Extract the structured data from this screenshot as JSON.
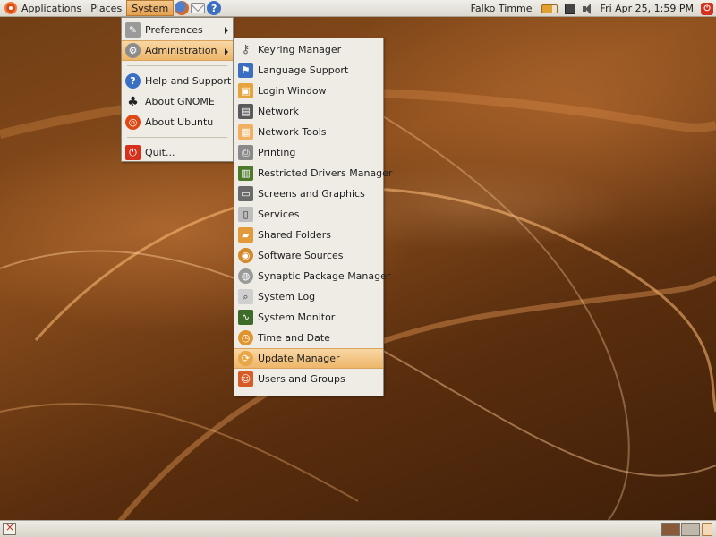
{
  "top_panel": {
    "menus": {
      "applications": "Applications",
      "places": "Places",
      "system": "System"
    },
    "user_name": "Falko Timme",
    "clock": "Fri Apr 25,  1:59 PM"
  },
  "system_menu": {
    "items": [
      {
        "label": "Preferences",
        "icon": "preferences-icon",
        "has_submenu": true
      },
      {
        "label": "Administration",
        "icon": "administration-icon",
        "has_submenu": true,
        "highlighted": true
      },
      {
        "label": "Help and Support",
        "icon": "help-icon"
      },
      {
        "label": "About GNOME",
        "icon": "gnome-foot-icon"
      },
      {
        "label": "About Ubuntu",
        "icon": "ubuntu-icon"
      },
      {
        "label": "Quit...",
        "icon": "quit-icon"
      }
    ]
  },
  "administration_menu": {
    "items": [
      {
        "label": "Keyring Manager",
        "icon": "keyring-icon"
      },
      {
        "label": "Language Support",
        "icon": "flag-icon"
      },
      {
        "label": "Login Window",
        "icon": "login-window-icon"
      },
      {
        "label": "Network",
        "icon": "network-icon"
      },
      {
        "label": "Network Tools",
        "icon": "network-tools-icon"
      },
      {
        "label": "Printing",
        "icon": "printer-icon"
      },
      {
        "label": "Restricted Drivers Manager",
        "icon": "drivers-icon"
      },
      {
        "label": "Screens and Graphics",
        "icon": "display-icon"
      },
      {
        "label": "Services",
        "icon": "services-icon"
      },
      {
        "label": "Shared Folders",
        "icon": "shared-folder-icon"
      },
      {
        "label": "Software Sources",
        "icon": "software-sources-icon"
      },
      {
        "label": "Synaptic Package Manager",
        "icon": "synaptic-icon"
      },
      {
        "label": "System Log",
        "icon": "system-log-icon"
      },
      {
        "label": "System Monitor",
        "icon": "system-monitor-icon"
      },
      {
        "label": "Time and Date",
        "icon": "clock-icon"
      },
      {
        "label": "Update Manager",
        "icon": "update-manager-icon",
        "highlighted": true
      },
      {
        "label": "Users and Groups",
        "icon": "users-groups-icon"
      }
    ]
  },
  "colors": {
    "accent": "#eeb66a",
    "panel": "#e6e2da",
    "desktop": "#7a4217"
  }
}
